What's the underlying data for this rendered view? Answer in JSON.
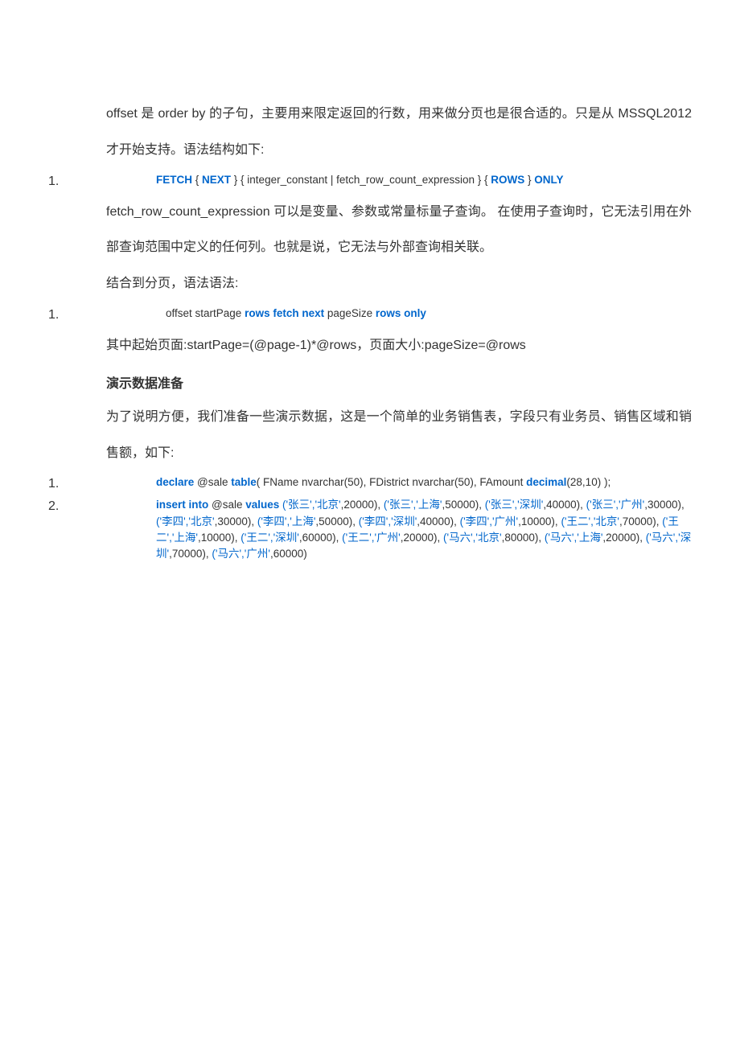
{
  "p1": "offset 是 order by 的子句，主要用来限定返回的行数，用来做分页也是很合适的。只是从 MSSQL2012 才开始支持。语法结构如下:",
  "code1_num": "1.",
  "c1_fetch": "FETCH",
  "c1_brace1": " { ",
  "c1_next": "NEXT",
  "c1_middle": " } { integer_constant | fetch_row_count_expression } { ",
  "c1_rows": "ROWS",
  "c1_brace2": " } ",
  "c1_only": "ONLY",
  "p2": "fetch_row_count_expression 可以是变量、参数或常量标量子查询。 在使用子查询时，它无法引用在外部查询范围中定义的任何列。也就是说，它无法与外部查询相关联。",
  "p3": "结合到分页，语法语法:",
  "code2_num": "1.",
  "c2_pre": "offset startPage ",
  "c2_rows_fetch_next": "rows fetch next",
  "c2_mid": " pageSize ",
  "c2_rows_only": "rows only",
  "p4": "其中起始页面:startPage=(@page-1)*@rows，页面大小:pageSize=@rows",
  "heading": "演示数据准备",
  "p5": "为了说明方便，我们准备一些演示数据，这是一个简单的业务销售表，字段只有业务员、销售区域和销售额，如下:",
  "code3_num": "1.",
  "c3_declare": "declare",
  "c3_sale": " @sale ",
  "c3_table": "table",
  "c3_mid": "( FName nvarchar(50), FDistrict nvarchar(50), FAmount ",
  "c3_decimal": "decimal",
  "c3_end": "(28,10) );",
  "code4_num": "2.",
  "c4_insert": "insert into",
  "c4_sale": " @sale ",
  "c4_values": "values",
  "c4_space": " ",
  "c4_t1": "('张三','北京'",
  "c4_n1": ",20000), ",
  "c4_t2": "('张三','上海'",
  "c4_n2": ",50000), ",
  "c4_t3": "('张三','深圳'",
  "c4_n3": ",40000), ",
  "c4_t4": "('张三','广州'",
  "c4_n4": ",30000), ",
  "c4_t5": "('李四','北京'",
  "c4_n5": ",30000), ",
  "c4_t6": "('李四','上海'",
  "c4_n6": ",50000), ",
  "c4_t7": "('李四','深圳'",
  "c4_n7": ",40000), ",
  "c4_t8": "('李四','广州'",
  "c4_n8": ",10000), ",
  "c4_t9": "('王二','北京'",
  "c4_n9": ",70000), ",
  "c4_t10": "('王二','上海'",
  "c4_n10": ",10000), ",
  "c4_t11": "('王二','深圳'",
  "c4_n11": ",60000), ",
  "c4_t12": "('王二','广州'",
  "c4_n12": ",20000), ",
  "c4_t13": "('马六','北京'",
  "c4_n13": ",80000), ",
  "c4_t14": "('马六','上海'",
  "c4_n14": ",20000), ",
  "c4_t15": "('马六','深圳'",
  "c4_n15": ",70000), ",
  "c4_t16": "('马六','广州'",
  "c4_n16": ",60000)"
}
